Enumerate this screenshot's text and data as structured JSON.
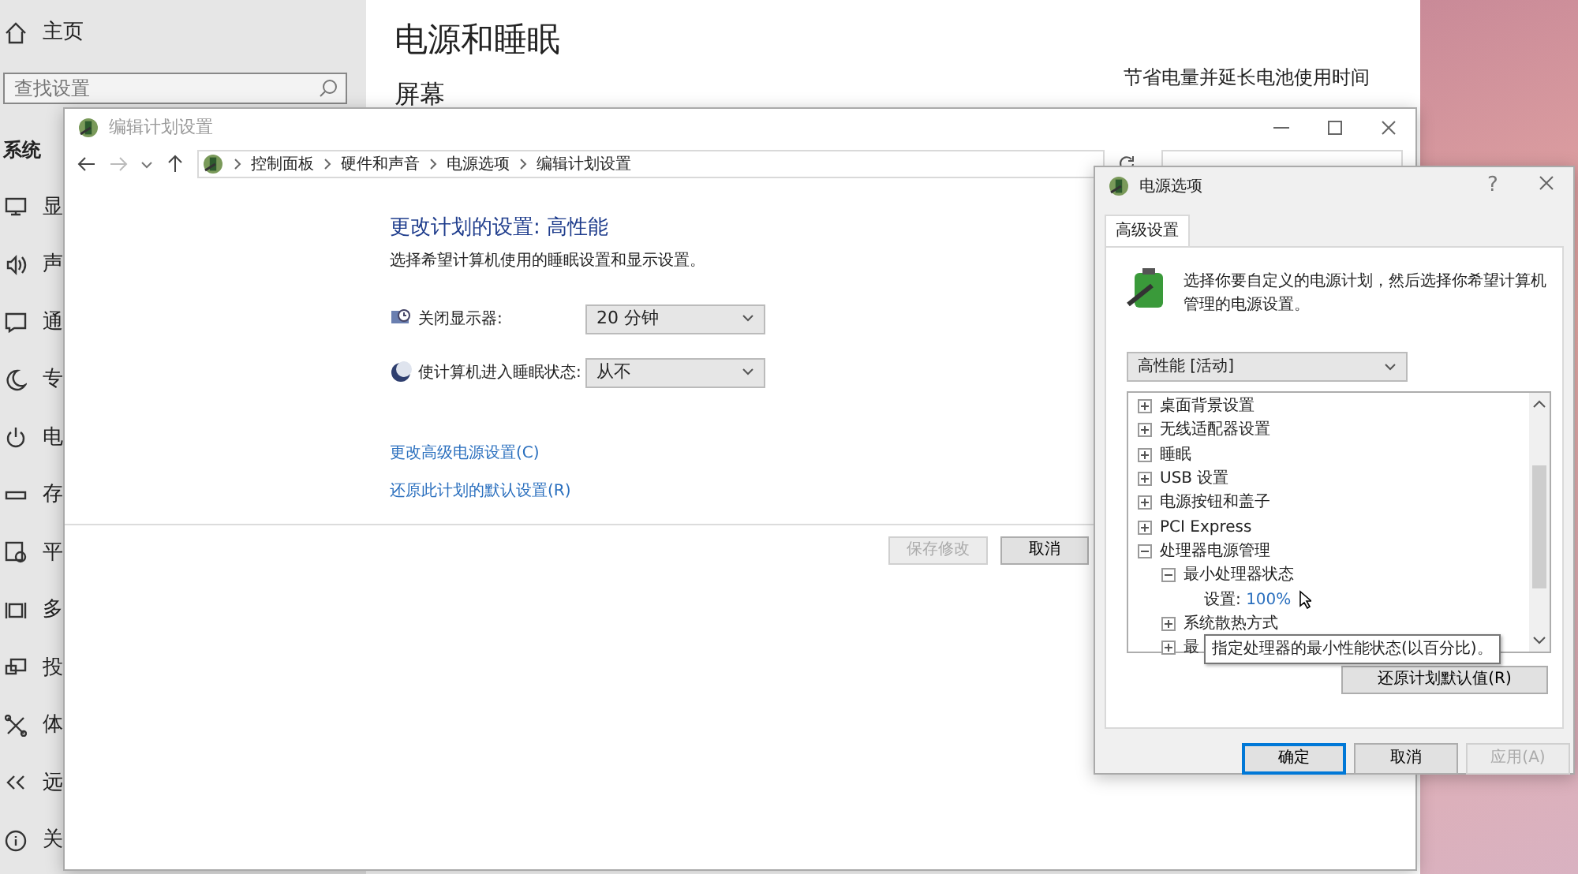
{
  "settings_window": {
    "home": "主页",
    "search": {
      "placeholder": "查找设置"
    },
    "section": "系统",
    "sidebar": {
      "items": [
        {
          "label": "显"
        },
        {
          "label": "声"
        },
        {
          "label": "通"
        },
        {
          "label": "专"
        },
        {
          "label": "电"
        },
        {
          "label": "存"
        },
        {
          "label": "平"
        },
        {
          "label": "多"
        },
        {
          "label": "投"
        },
        {
          "label": "体"
        },
        {
          "label": "远"
        },
        {
          "label": "关"
        }
      ]
    },
    "title": "电源和睡眠",
    "subtitle": "屏幕",
    "side_note": "节省电量并延长电池使用时间"
  },
  "plan_window": {
    "title": "编辑计划设置",
    "breadcrumbs": [
      "控制面板",
      "硬件和声音",
      "电源选项",
      "编辑计划设置"
    ],
    "heading": "更改计划的设置: 高性能",
    "description": "选择希望计算机使用的睡眠设置和显示设置。",
    "settings": [
      {
        "label": "关闭显示器:",
        "value": "20 分钟"
      },
      {
        "label": "使计算机进入睡眠状态:",
        "value": "从不"
      }
    ],
    "links": [
      "更改高级电源设置(C)",
      "还原此计划的默认设置(R)"
    ],
    "buttons": [
      {
        "label": "保存修改",
        "disabled": true
      },
      {
        "label": "取消",
        "disabled": false
      }
    ]
  },
  "power_dialog": {
    "title": "电源选项",
    "help": "?",
    "tabs": [
      {
        "label": "高级设置",
        "selected": true
      }
    ],
    "intro": "选择你要自定义的电源计划，然后选择你希望计算机管理的电源设置。",
    "plan": "高性能 [活动]",
    "tree": [
      {
        "label": "桌面背景设置",
        "expanded": false
      },
      {
        "label": "无线适配器设置",
        "expanded": false
      },
      {
        "label": "睡眠",
        "expanded": false
      },
      {
        "label": "USB 设置",
        "expanded": false
      },
      {
        "label": "电源按钮和盖子",
        "expanded": false
      },
      {
        "label": "PCI Express",
        "expanded": false
      },
      {
        "label": "处理器电源管理",
        "expanded": true,
        "children": [
          {
            "label": "最小处理器状态",
            "expanded": true,
            "children": [
              {
                "kind": "setting",
                "label": "设置:",
                "value": "100%"
              }
            ]
          },
          {
            "label": "系统散热方式",
            "expanded": false
          },
          {
            "label": "最",
            "expanded": false
          }
        ]
      }
    ],
    "tooltip": "指定处理器的最小性能状态(以百分比)。",
    "restore_button": "还原计划默认值(R)",
    "buttons": [
      {
        "label": "确定",
        "disabled": false,
        "selected": true
      },
      {
        "label": "取消",
        "disabled": false,
        "selected": false
      },
      {
        "label": "应用(A)",
        "disabled": true,
        "selected": false
      }
    ]
  }
}
